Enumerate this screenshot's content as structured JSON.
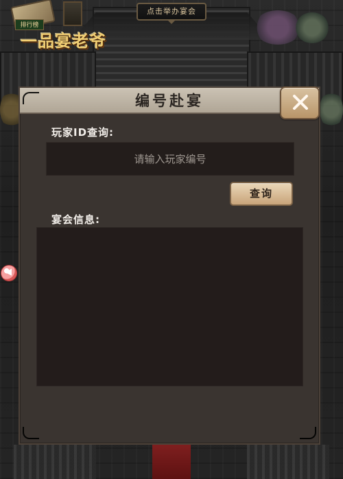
{
  "game": {
    "logo_text": "一品宴老爷",
    "top_banner": "点击举办宴会",
    "small_tag": "排行榜"
  },
  "dialog": {
    "title": "编号赴宴",
    "close_icon": "close-icon"
  },
  "query": {
    "label": "玩家ID查询:",
    "placeholder": "请输入玩家编号",
    "value": "",
    "button_label": "查询"
  },
  "banquet_info": {
    "label": "宴会信息:"
  },
  "colors": {
    "panel_bg": "#3a3430",
    "header_bg": "#bcb1a3",
    "button_bg": "#d8bc97",
    "input_bg": "#231d1b",
    "accent_red": "#d75858"
  }
}
